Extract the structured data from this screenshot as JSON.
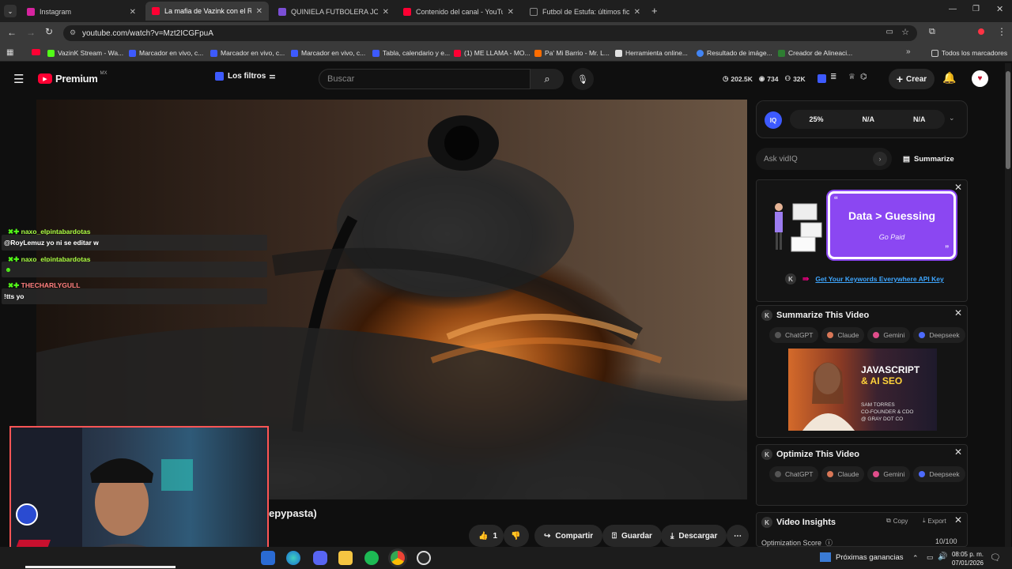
{
  "tabs": [
    {
      "title": "Instagram",
      "color": "#d6249f",
      "active": false
    },
    {
      "title": "La mafia de Vazink con el Rey d",
      "color": "#ff0033",
      "active": true
    },
    {
      "title": "QUINIELA FUTBOLERA JORNAD",
      "color": "#7b4fd6",
      "active": false
    },
    {
      "title": "Contenido del canal - YouTube",
      "color": "#ff0033",
      "active": false
    },
    {
      "title": "Futbol de Estufa: últimos fichaje",
      "color": "#ffffff",
      "active": false
    }
  ],
  "address": {
    "url": "youtube.com/watch?v=Mzt2ICGFpuA"
  },
  "bookmarks": [
    {
      "label": "VazinK Stream - Wa...",
      "color": "#53fc18"
    },
    {
      "label": "Marcador en vivo, c...",
      "color": "#3d5afe"
    },
    {
      "label": "Marcador en vivo, c...",
      "color": "#3d5afe"
    },
    {
      "label": "Marcador en vivo, c...",
      "color": "#3d5afe"
    },
    {
      "label": "Tabla, calendario y e...",
      "color": "#3d5afe"
    },
    {
      "label": "(1) ME LLAMA - MO...",
      "color": "#ff0033"
    },
    {
      "label": "Pa' Mi Barrio - Mr. L...",
      "color": "#ff6d00"
    },
    {
      "label": "Herramienta online...",
      "color": "#e0e0e0"
    },
    {
      "label": "Resultado de imáge...",
      "color": "#4285f4"
    },
    {
      "label": "Creador de Alineaci...",
      "color": "#2e7d32"
    }
  ],
  "bookmarks_all": "Todos los marcadores",
  "yt": {
    "logo": "Premium",
    "region": "MX",
    "filters": "Los filtros",
    "search_placeholder": "Buscar",
    "stat_views": "202.5K",
    "stat_likes": "734",
    "stat_subs": "32K",
    "create": "Crear"
  },
  "chat": [
    {
      "user": "naxo_elpintabardotas",
      "msg": "@RoyLemuz yo ni se editar w",
      "color": "#aaff44"
    },
    {
      "user": "naxo_elpintabardotas",
      "msg": "",
      "color": "#aaff44"
    },
    {
      "user": "THECHARLYGULL",
      "msg": "!tts yo",
      "color": "#ff7f7f"
    }
  ],
  "video": {
    "title_fragment": "epypasta)"
  },
  "actions": {
    "like_count": "1",
    "share": "Compartir",
    "save": "Guardar",
    "download": "Descargar"
  },
  "vidiq": {
    "badge": "IQ",
    "score": "25%",
    "na1": "N/A",
    "na2": "N/A",
    "ask": "Ask vidIQ",
    "summarize": "Summarize"
  },
  "ad1": {
    "headline": "Data > Guessing",
    "sub": "Go Paid",
    "link": "Get Your Keywords Everywhere API Key"
  },
  "summarize_card": {
    "title": "Summarize This Video",
    "ai": [
      "ChatGPT",
      "Claude",
      "Gemini",
      "Deepseek"
    ],
    "ad_line1": "JAVASCRIPT",
    "ad_line2": "& AI SEO",
    "ad_name": "SAM TORRES",
    "ad_role": "CO-FOUNDER & CDO",
    "ad_company": "@ GRAY DOT CO"
  },
  "optimize_card": {
    "title": "Optimize This Video",
    "ai": [
      "ChatGPT",
      "Claude",
      "Gemini",
      "Deepseek"
    ]
  },
  "insights_card": {
    "title": "Video Insights",
    "copy": "Copy",
    "export": "Export",
    "label": "Optimization Score",
    "value": "10/100"
  },
  "taskbar": {
    "news": "Próximas ganancias",
    "time": "08:05 p. m.",
    "date": "07/01/2026"
  }
}
